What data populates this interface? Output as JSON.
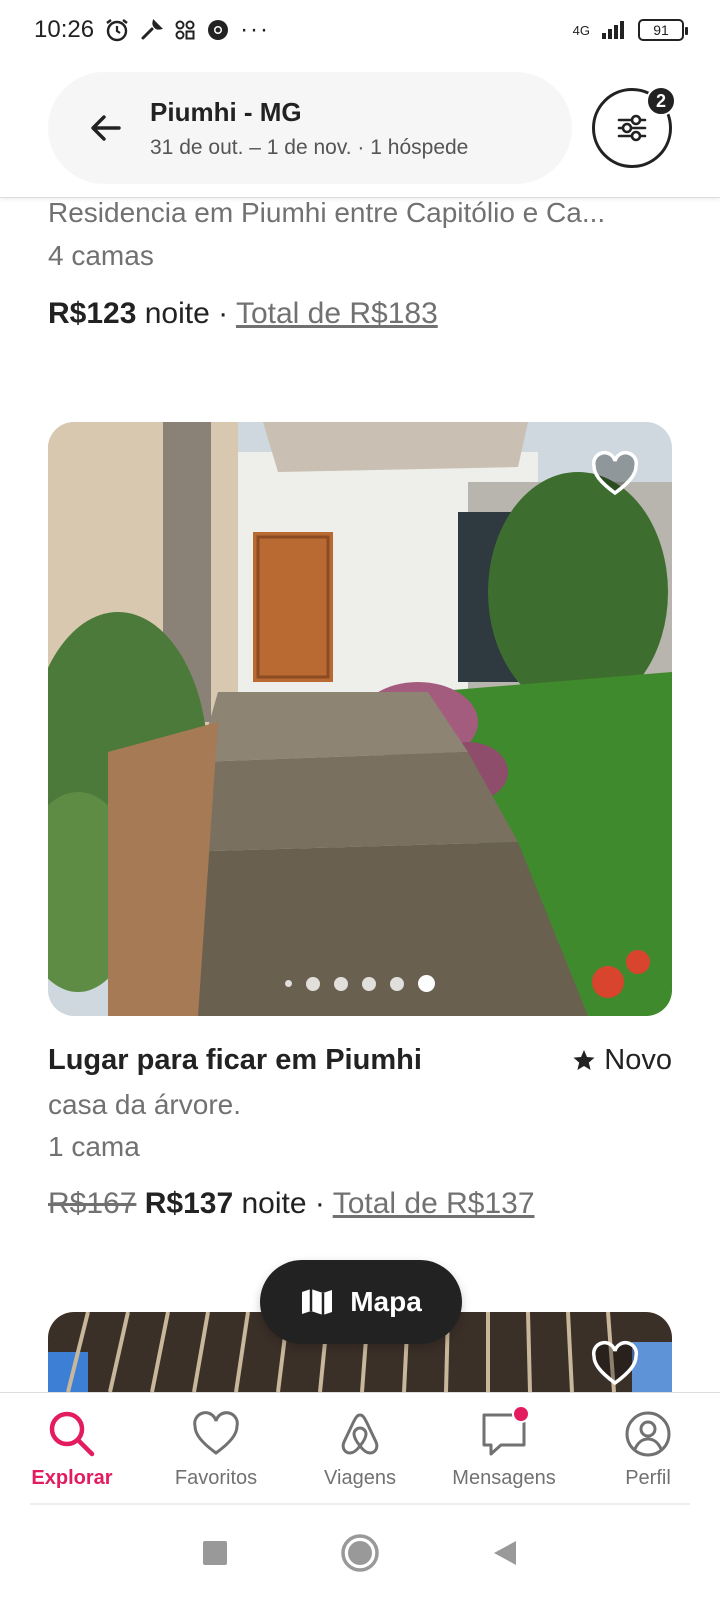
{
  "status_bar": {
    "time": "10:26",
    "network": "4G",
    "battery": "91"
  },
  "search": {
    "location": "Piumhi - MG",
    "details": "31 de out. – 1 de nov. · 1 hóspede",
    "filter_count": "2"
  },
  "listing_previous": {
    "title": "Residencia em Piumhi entre  Capitólio e Ca...",
    "beds": "4 camas",
    "price": "R$123",
    "per": "noite",
    "separator": "·",
    "total": "Total de R$183"
  },
  "listing_current": {
    "title": "Lugar para ficar em Piumhi",
    "rating_label": "Novo",
    "subtitle": "casa da árvore.",
    "beds": "1 cama",
    "old_price": "R$167",
    "price": "R$137",
    "per": "noite",
    "separator": "·",
    "total": "Total de R$137",
    "photo_count": 6,
    "photo_active_index": 5
  },
  "map_button": {
    "label": "Mapa"
  },
  "bottom_nav": {
    "items": [
      {
        "label": "Explorar",
        "icon": "search-icon",
        "active": true
      },
      {
        "label": "Favoritos",
        "icon": "heart-icon",
        "active": false
      },
      {
        "label": "Viagens",
        "icon": "airbnb-logo-icon",
        "active": false
      },
      {
        "label": "Mensagens",
        "icon": "message-icon",
        "active": false
      },
      {
        "label": "Perfil",
        "icon": "profile-icon",
        "active": false
      }
    ]
  },
  "colors": {
    "accent": "#e31c5f",
    "text": "#222222",
    "muted": "#717171"
  }
}
